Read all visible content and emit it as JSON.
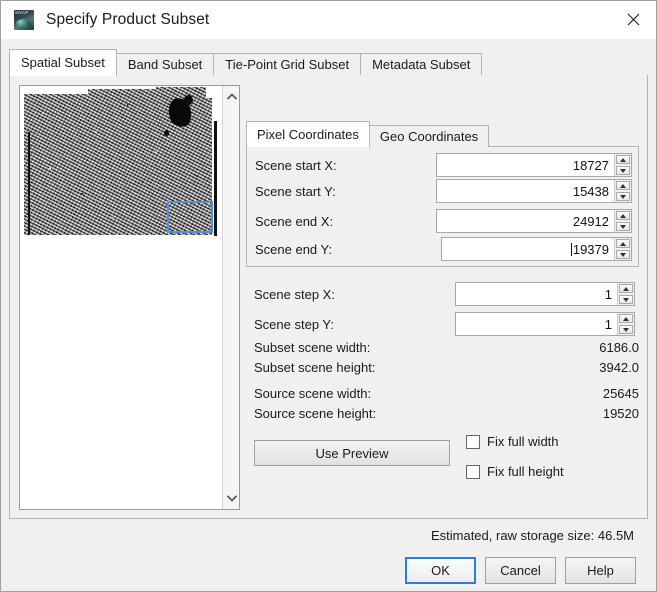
{
  "window": {
    "title": "Specify Product Subset",
    "icon": "snap-app-icon",
    "close_icon": "close-icon"
  },
  "tabs": [
    {
      "label": "Spatial Subset",
      "active": true
    },
    {
      "label": "Band Subset",
      "active": false
    },
    {
      "label": "Tie-Point Grid Subset",
      "active": false
    },
    {
      "label": "Metadata Subset",
      "active": false
    }
  ],
  "preview": {
    "name": "scene-preview-thumbnail",
    "selection_rect": "subset-selection-rectangle",
    "scrollbar": {
      "up_icon": "chevron-up-icon",
      "down_icon": "chevron-down-icon"
    }
  },
  "coordinates": {
    "tabs": [
      {
        "label": "Pixel Coordinates",
        "active": true
      },
      {
        "label": "Geo Coordinates",
        "active": false
      }
    ],
    "fields": [
      {
        "label": "Scene start X:",
        "value": "18727",
        "caret": false
      },
      {
        "label": "Scene start Y:",
        "value": "15438",
        "caret": false
      },
      {
        "label": "Scene end X:",
        "value": "24912",
        "caret": false
      },
      {
        "label": "Scene end Y:",
        "value": "19379",
        "caret": true
      }
    ]
  },
  "steps": [
    {
      "label": "Scene step X:",
      "value": "1"
    },
    {
      "label": "Scene step Y:",
      "value": "1"
    }
  ],
  "info": [
    {
      "label": "Subset scene width:",
      "value": "6186.0"
    },
    {
      "label": "Subset scene height:",
      "value": "3942.0"
    },
    {
      "label": "Source scene width:",
      "value": "25645"
    },
    {
      "label": "Source scene height:",
      "value": "19520"
    }
  ],
  "actions": {
    "use_preview": "Use Preview",
    "fix_full_width": {
      "label": "Fix full width",
      "checked": false
    },
    "fix_full_height": {
      "label": "Fix full height",
      "checked": false
    }
  },
  "footer": {
    "estimate": "Estimated, raw storage size: 46.5M",
    "ok": "OK",
    "cancel": "Cancel",
    "help": "Help"
  },
  "colors": {
    "dialog_bg": "#f0f0f0",
    "titlebar_bg": "#ffffff",
    "accent_focus": "#2f7fd0",
    "selection_rect": "#4f90d8",
    "border": "#b4b4b4"
  }
}
